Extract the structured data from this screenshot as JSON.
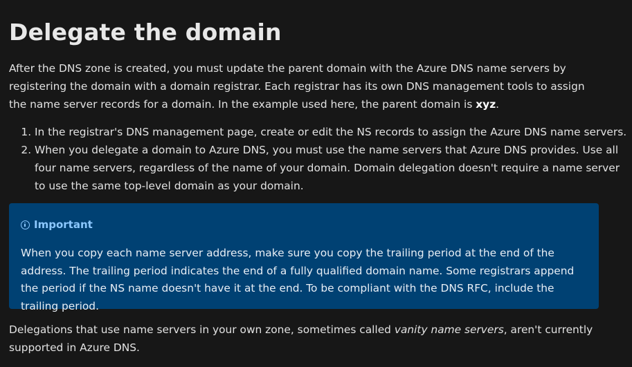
{
  "heading": "Delegate the domain",
  "intro": {
    "text_before": "After the DNS zone is created, you must update the parent domain with the Azure DNS name servers by registering the domain with a domain registrar. Each registrar has its own DNS management tools to assign the name server records for a domain. In the example used here, the parent domain is ",
    "domain": "xyz",
    "text_after": "."
  },
  "steps": [
    "In the registrar's DNS management page, create or edit the NS records to assign the Azure DNS name servers.",
    "When you delegate a domain to Azure DNS, you must use the name servers that Azure DNS provides. Use all four name servers, regardless of the name of your domain. Domain delegation doesn't require a name server to use the same top-level domain as your domain."
  ],
  "alert": {
    "icon": "info-icon",
    "title": "Important",
    "body": "When you copy each name server address, make sure you copy the trailing period at the end of the address. The trailing period indicates the end of a fully qualified domain name. Some registrars append the period if the NS name doesn't have it at the end. To be compliant with the DNS RFC, include the trailing period.",
    "background": "#004173",
    "title_color": "#8cc8ff"
  },
  "outro": {
    "text_before": "Delegations that use name servers in your own zone, sometimes called ",
    "emphasis": "vanity name servers",
    "text_after": ", aren't currently supported in Azure DNS."
  }
}
